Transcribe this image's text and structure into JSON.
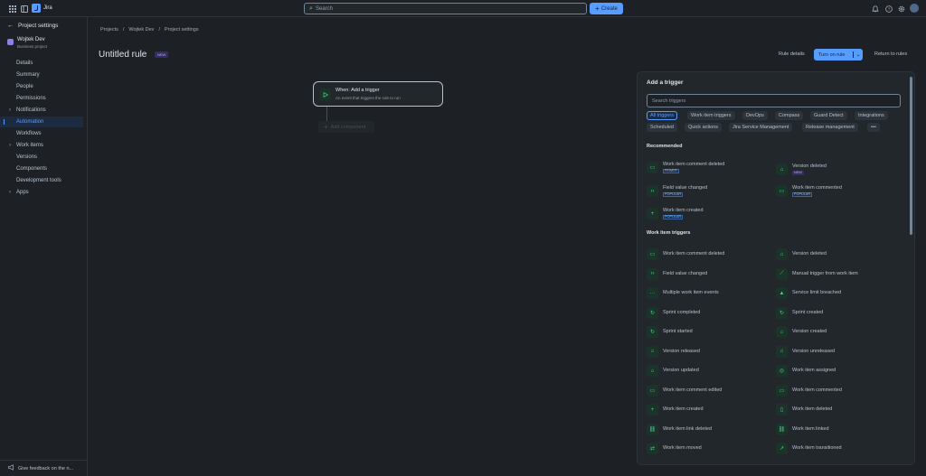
{
  "app": {
    "name": "Jira"
  },
  "topbar": {
    "search_placeholder": "Search",
    "create_label": "Create"
  },
  "sidebar": {
    "back_label": "Project settings",
    "project_name": "Wojtek Dev",
    "project_type": "Business project",
    "items": [
      {
        "label": "Details",
        "chevron": false,
        "active": false
      },
      {
        "label": "Summary",
        "chevron": false,
        "active": false
      },
      {
        "label": "People",
        "chevron": false,
        "active": false
      },
      {
        "label": "Permissions",
        "chevron": false,
        "active": false
      },
      {
        "label": "Notifications",
        "chevron": true,
        "active": false
      },
      {
        "label": "Automation",
        "chevron": false,
        "active": true
      },
      {
        "label": "Workflows",
        "chevron": false,
        "active": false
      },
      {
        "label": "Work items",
        "chevron": true,
        "active": false
      },
      {
        "label": "Versions",
        "chevron": false,
        "active": false
      },
      {
        "label": "Components",
        "chevron": false,
        "active": false
      },
      {
        "label": "Development tools",
        "chevron": false,
        "active": false
      },
      {
        "label": "Apps",
        "chevron": true,
        "active": false
      }
    ],
    "feedback_label": "Give feedback on the n..."
  },
  "breadcrumb": [
    "Projects",
    "Wojtek Dev",
    "Project settings"
  ],
  "rule": {
    "title": "Untitled rule",
    "new_badge": "NEW",
    "rule_details": "Rule details",
    "turn_on": "Turn on rule",
    "return": "Return to rules"
  },
  "canvas": {
    "trigger_title": "When: Add a trigger",
    "trigger_sub": "An event that triggers the rule to run",
    "add_component": "Add component"
  },
  "panel": {
    "title": "Add a trigger",
    "search_placeholder": "Search triggers",
    "chips_row1": [
      "All triggers",
      "Work item triggers",
      "DevOps",
      "Compass",
      "Guard Detect",
      "Integrations"
    ],
    "chips_row2": [
      "Scheduled",
      "Quick actions",
      "Jira Service Management",
      "Release management",
      "•••"
    ],
    "recommended_heading": "Recommended",
    "recommended": [
      {
        "label": "Work item comment deleted",
        "badge": "FEWER",
        "badge_style": "blue",
        "icon": "comment-icon"
      },
      {
        "label": "Version deleted",
        "badge": "NEW",
        "badge_style": "purple",
        "icon": "version-icon"
      },
      {
        "label": "Field value changed",
        "badge": "POPULAR",
        "badge_style": "blue",
        "icon": "field-icon"
      },
      {
        "label": "Work item commented",
        "badge": "POPULAR",
        "badge_style": "blue",
        "icon": "comment-icon"
      },
      {
        "label": "Work item created",
        "badge": "POPULAR",
        "badge_style": "blue",
        "icon": "plus-icon"
      }
    ],
    "work_item_heading": "Work item triggers",
    "work_item": [
      {
        "label": "Work item comment deleted",
        "icon": "comment-icon"
      },
      {
        "label": "Version deleted",
        "icon": "version-icon"
      },
      {
        "label": "Field value changed",
        "icon": "field-icon"
      },
      {
        "label": "Manual trigger from work item",
        "icon": "manual-icon"
      },
      {
        "label": "Multiple work item events",
        "icon": "dots-icon"
      },
      {
        "label": "Service limit breached",
        "icon": "warning-icon"
      },
      {
        "label": "Sprint completed",
        "icon": "sprint-icon"
      },
      {
        "label": "Sprint created",
        "icon": "sprint-icon"
      },
      {
        "label": "Sprint started",
        "icon": "sprint-icon"
      },
      {
        "label": "Version created",
        "icon": "version-icon"
      },
      {
        "label": "Version released",
        "icon": "version-icon"
      },
      {
        "label": "Version unreleased",
        "icon": "version-icon"
      },
      {
        "label": "Version updated",
        "icon": "version-icon"
      },
      {
        "label": "Work item assigned",
        "icon": "assign-icon"
      },
      {
        "label": "Work item comment edited",
        "icon": "comment-icon"
      },
      {
        "label": "Work item commented",
        "icon": "comment-icon"
      },
      {
        "label": "Work item created",
        "icon": "plus-icon"
      },
      {
        "label": "Work item deleted",
        "icon": "trash-icon"
      },
      {
        "label": "Work item link deleted",
        "icon": "link-icon"
      },
      {
        "label": "Work item linked",
        "icon": "link-icon"
      },
      {
        "label": "Work item moved",
        "icon": "move-icon"
      },
      {
        "label": "Work item transitioned",
        "icon": "transition-icon"
      }
    ]
  },
  "colors": {
    "accent": "#579dff",
    "trigger_icon_bg": "#1c3329",
    "trigger_icon_fg": "#4bce97",
    "new_badge": "#b8acf6"
  }
}
